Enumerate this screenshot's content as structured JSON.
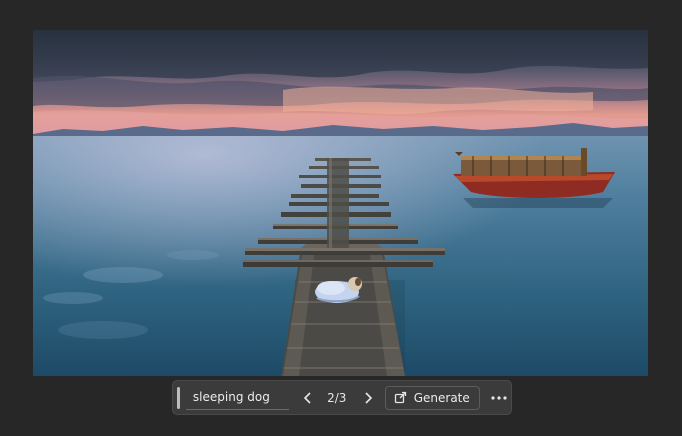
{
  "prompt": {
    "value": "sleeping dog"
  },
  "variation": {
    "current": 2,
    "total": 3,
    "label": "2/3"
  },
  "buttons": {
    "previous_icon": "chevron-left-icon",
    "next_icon": "chevron-right-icon",
    "generate_label": "Generate",
    "generate_icon": "generate-icon",
    "more_icon": "more-horizontal-icon"
  },
  "colors": {
    "app_background": "#272727",
    "toolbar_background": "#3b3b3b",
    "toolbar_text": "#e6e6e6"
  }
}
